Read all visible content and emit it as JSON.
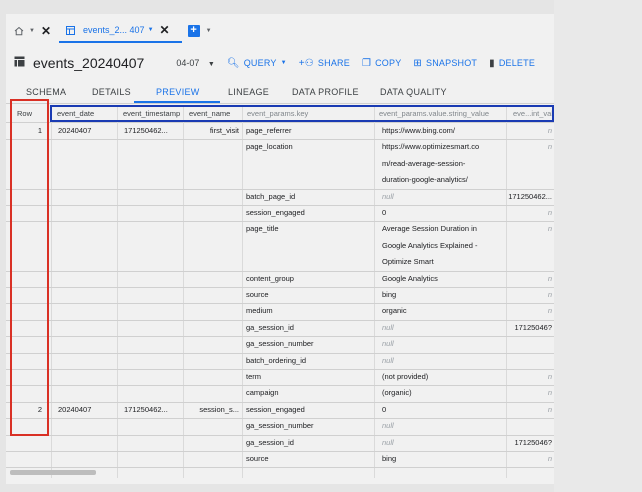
{
  "tabbar": {
    "home_icon": "home-icon",
    "tab_icon": "table-icon",
    "tab_label": "events_2... 407",
    "add_icon": "plus-icon"
  },
  "header": {
    "table_icon": "table-icon",
    "title": "events_20240407",
    "date_select": "04-07",
    "actions": [
      {
        "label": "QUERY",
        "icon": "search-icon"
      },
      {
        "label": "SHARE",
        "icon": "person-add-icon"
      },
      {
        "label": "COPY",
        "icon": "copy-icon"
      },
      {
        "label": "SNAPSHOT",
        "icon": "snapshot-icon"
      },
      {
        "label": "DELETE",
        "icon": "trash-icon"
      }
    ]
  },
  "subtabs": [
    "SCHEMA",
    "DETAILS",
    "PREVIEW",
    "LINEAGE",
    "DATA PROFILE",
    "DATA QUALITY"
  ],
  "active_subtab": "PREVIEW",
  "columns": [
    "Row",
    "event_date",
    "event_timestamp",
    "event_name",
    "event_params.key",
    "event_params.value.string_value",
    "eve...int_val"
  ],
  "rows": [
    {
      "row": "1",
      "event_date": "20240407",
      "event_timestamp": "171250462...",
      "event_name": "first_visit"
    },
    {
      "row": "2",
      "event_date": "20240407",
      "event_timestamp": "171250462...",
      "event_name": "session_s..."
    }
  ],
  "params": [
    {
      "key": "page_referrer",
      "string": [
        "https://www.bing.com/"
      ],
      "int": "n"
    },
    {
      "key": "page_location",
      "string": [
        "https://www.optimizesmart.co",
        "m/read-average-session-",
        "duration-google-analytics/"
      ],
      "int": "n"
    },
    {
      "key": "batch_page_id",
      "string": [
        "null"
      ],
      "int": "171250462..."
    },
    {
      "key": "session_engaged",
      "string": [
        "0"
      ],
      "int": "n"
    },
    {
      "key": "page_title",
      "string": [
        "Average Session Duration in",
        "Google Analytics Explained -",
        "Optimize Smart"
      ],
      "int": "n"
    },
    {
      "key": "content_group",
      "string": [
        "Google Analytics"
      ],
      "int": "n"
    },
    {
      "key": "source",
      "string": [
        "bing"
      ],
      "int": "n"
    },
    {
      "key": "medium",
      "string": [
        "organic"
      ],
      "int": "n"
    },
    {
      "key": "ga_session_id",
      "string": [
        "null"
      ],
      "int": "17125046?"
    },
    {
      "key": "ga_session_number",
      "string": [
        "null"
      ],
      "int": ""
    },
    {
      "key": "batch_ordering_id",
      "string": [
        "null"
      ],
      "int": ""
    },
    {
      "key": "term",
      "string": [
        "(not provided)"
      ],
      "int": "n"
    },
    {
      "key": "campaign",
      "string": [
        "(organic)"
      ],
      "int": "n"
    },
    {
      "key": "session_engaged",
      "string": [
        "0"
      ],
      "int": "n"
    },
    {
      "key": "ga_session_number",
      "string": [
        "null"
      ],
      "int": ""
    },
    {
      "key": "ga_session_id",
      "string": [
        "null"
      ],
      "int": "17125046?"
    },
    {
      "key": "source",
      "string": [
        "bing"
      ],
      "int": "n"
    }
  ],
  "highlight_colors": {
    "row_box": "#d93025",
    "header_box": "#1a3bb3"
  }
}
